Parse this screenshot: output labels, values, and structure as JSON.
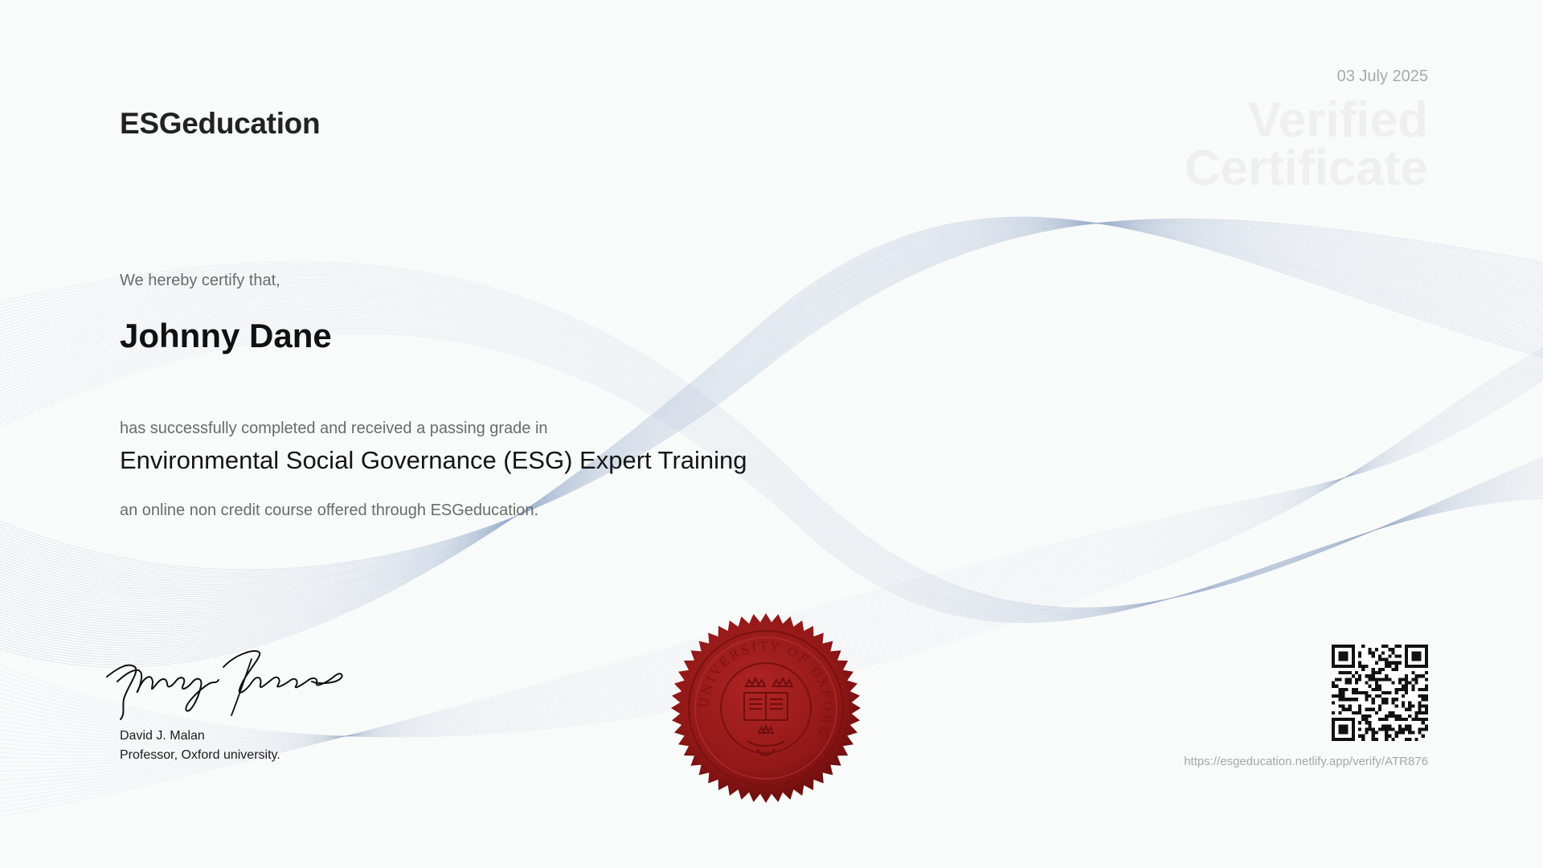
{
  "brand": "ESGeducation",
  "date": "03 July 2025",
  "watermark": {
    "line1": "Verified",
    "line2": "Certificate"
  },
  "certify_text": "We hereby certify that,",
  "recipient_name": "Johnny Dane",
  "completion_text": "has successfully completed and received a passing grade in",
  "course_title": "Environmental Social Governance (ESG) Expert Training",
  "offered_text": "an online non credit course offered through ESGeducation.",
  "signer": {
    "name": "David J. Malan",
    "title": "Professor, Oxford university.",
    "signature_text": "Marilyn Monroe"
  },
  "seal": {
    "text": "UNIVERSITY OF OXFORD",
    "color": "#9b1b1b"
  },
  "verify_url": "https://esgeducation.netlify.app/verify/ATR876",
  "colors": {
    "wave": "#9fb3cf",
    "text_muted": "#6b6b6b",
    "text_dark": "#111111"
  }
}
